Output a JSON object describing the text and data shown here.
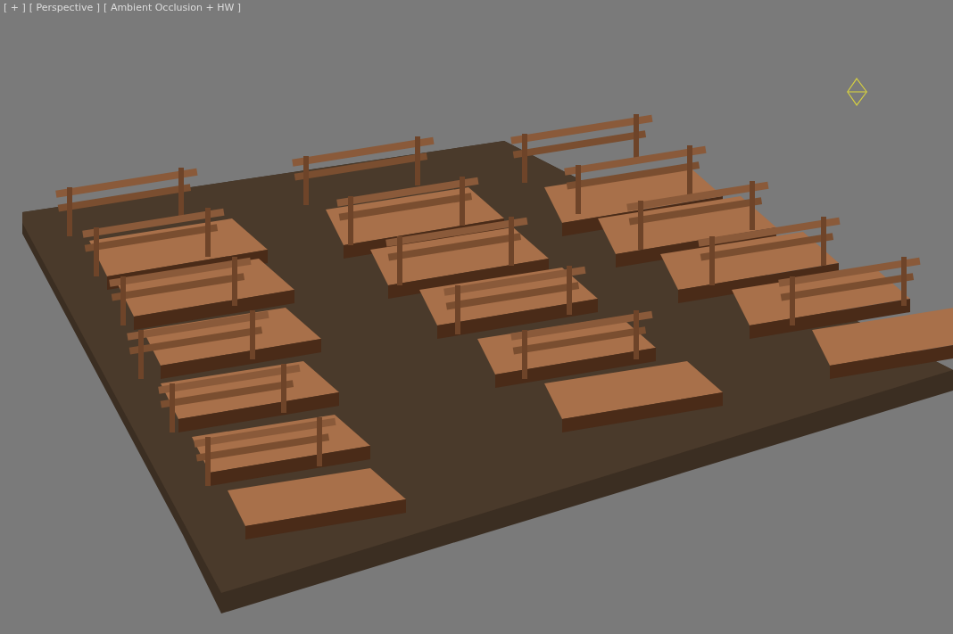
{
  "viewport": {
    "labels": [
      {
        "text": "[ + ]"
      },
      {
        "text": "[ Perspective ]"
      },
      {
        "text": "[ Ambient Occlusion + HW ]"
      }
    ]
  }
}
